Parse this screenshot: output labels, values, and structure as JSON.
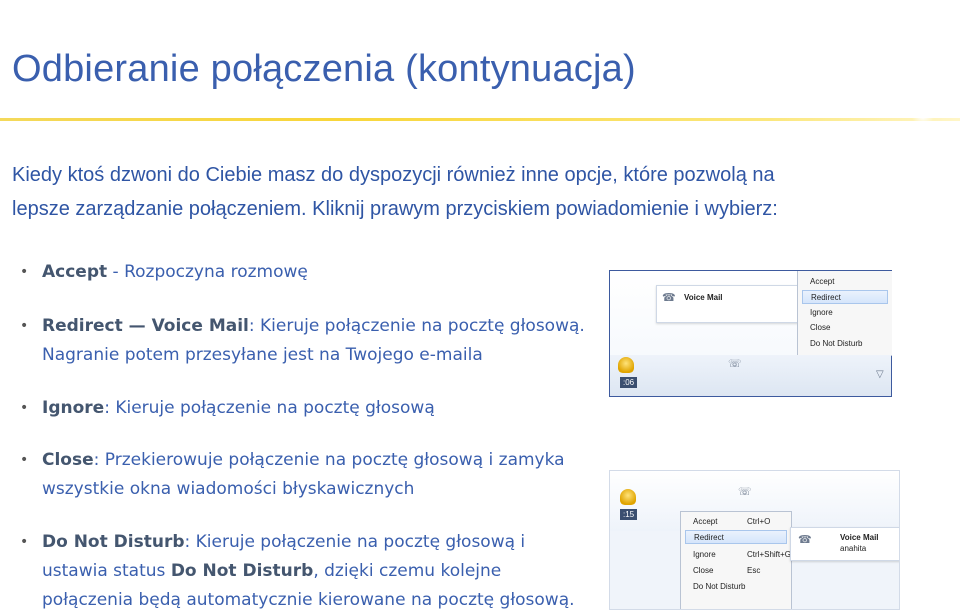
{
  "title": "Odbieranie połączenia (kontynuacja)",
  "intro": {
    "line1": "Kiedy ktoś dzwoni do Ciebie masz do dyspozycji również inne opcje, które pozwolą na",
    "line2": "lepsze zarządzanie połączeniem. Kliknij prawym przyciskiem powiadomienie i wybierz:"
  },
  "bullets": [
    {
      "bold": "Accept",
      "text": " - Rozpoczyna rozmowę"
    },
    {
      "bold": "Redirect — Voice Mail",
      "text": ": Kieruje połączenie na pocztę głosową.",
      "line2": "Nagranie potem przesyłane jest na Twojego e-maila"
    },
    {
      "bold": "Ignore",
      "text": ": Kieruje połączenie na pocztę głosową"
    },
    {
      "bold": "Close",
      "text": ": Przekierowuje połączenie na pocztę głosową i zamyka",
      "line2": "wszystkie okna wiadomości błyskawicznych"
    },
    {
      "bold": "Do Not Disturb",
      "text": ": Kieruje połączenie na pocztę głosową i",
      "line2a": "ustawia status ",
      "line2bold": "Do Not Disturb",
      "line2b": ", dzięki czemu kolejne",
      "line3": "połączenia będą automatycznie kierowane na pocztę głosową."
    }
  ],
  "shot1": {
    "toast_title": "Voice Mail",
    "timer": ":06",
    "menu": [
      "Accept",
      "Redirect",
      "Ignore",
      "Close",
      "Do Not Disturb"
    ],
    "highlighted": "Redirect"
  },
  "shot2": {
    "toast_title": "Voice Mail",
    "toast_sub": "anahita",
    "timer": ":15",
    "menu": [
      {
        "label": "Accept",
        "shortcut": "Ctrl+O"
      },
      {
        "label": "Redirect",
        "shortcut": ""
      },
      {
        "label": "Ignore",
        "shortcut": "Ctrl+Shift+G"
      },
      {
        "label": "Close",
        "shortcut": "Esc"
      },
      {
        "label": "Do Not Disturb",
        "shortcut": ""
      }
    ],
    "highlighted": "Redirect"
  },
  "colors": {
    "title": "#3a5fae",
    "accent_rule": "#f8d63a",
    "body_text": "#3a5fae",
    "bold_text": "#44566f"
  }
}
